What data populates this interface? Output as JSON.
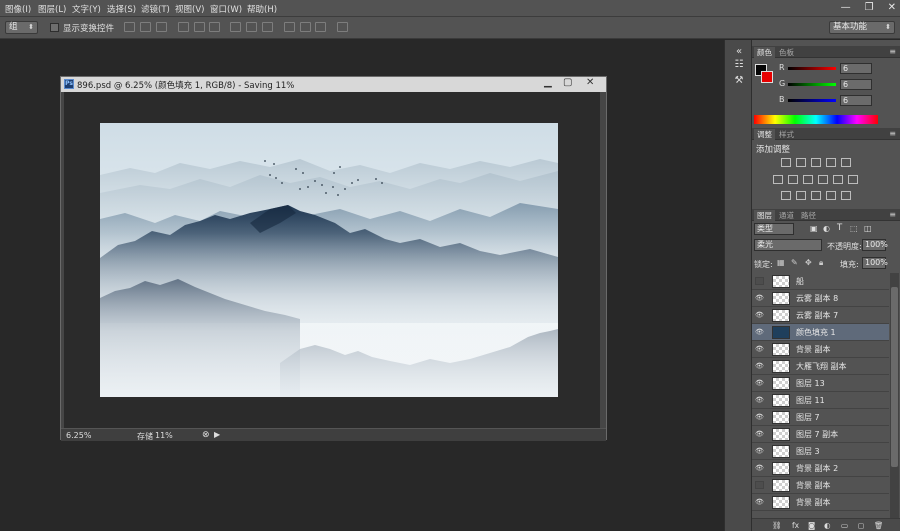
{
  "menu": [
    {
      "label": "图像(I)"
    },
    {
      "label": "图层(L)"
    },
    {
      "label": "文字(Y)"
    },
    {
      "label": "选择(S)"
    },
    {
      "label": "滤镜(T)"
    },
    {
      "label": "视图(V)"
    },
    {
      "label": "窗口(W)"
    },
    {
      "label": "帮助(H)"
    }
  ],
  "options": {
    "select_value": "组",
    "show_transform": "显示变换控件",
    "workspace": "基本功能"
  },
  "document": {
    "title": "896.psd @ 6.25% (颜色填充 1, RGB/8) - Saving 11%",
    "zoom": "6.25%",
    "status_label": "存储",
    "status_progress": "11%"
  },
  "color_panel": {
    "tabs": [
      "颜色",
      "色板"
    ],
    "r_label": "R",
    "g_label": "G",
    "b_label": "B",
    "r_value": "6",
    "g_value": "6",
    "b_value": "6",
    "fg_color": "#060606",
    "bg_color": "#e60000"
  },
  "adjust_panel": {
    "tabs": [
      "调整",
      "样式"
    ],
    "title": "添加调整"
  },
  "layers_panel": {
    "tabs": [
      "图层",
      "通道",
      "路径"
    ],
    "kind": "类型",
    "blend_mode": "柔光",
    "opacity_label": "不透明度:",
    "opacity_value": "100%",
    "lock_label": "锁定:",
    "fill_label": "填充:",
    "fill_value": "100%",
    "layers": [
      {
        "name": "船",
        "visible": false,
        "type": "transparent",
        "selected": false
      },
      {
        "name": "云雾 副本 8",
        "visible": true,
        "type": "transparent",
        "selected": false
      },
      {
        "name": "云雾 副本 7",
        "visible": true,
        "type": "transparent",
        "selected": false
      },
      {
        "name": "颜色填充 1",
        "visible": true,
        "type": "fill",
        "selected": true
      },
      {
        "name": "背景 副本",
        "visible": true,
        "type": "transparent",
        "selected": false
      },
      {
        "name": "大雁飞翔 副本",
        "visible": true,
        "type": "transparent",
        "selected": false
      },
      {
        "name": "图层 13",
        "visible": true,
        "type": "transparent",
        "selected": false
      },
      {
        "name": "图层 11",
        "visible": true,
        "type": "transparent",
        "selected": false
      },
      {
        "name": "图层 7",
        "visible": true,
        "type": "transparent",
        "selected": false
      },
      {
        "name": "图层 7 副本",
        "visible": true,
        "type": "transparent",
        "selected": false
      },
      {
        "name": "图层 3",
        "visible": true,
        "type": "transparent",
        "selected": false
      },
      {
        "name": "背景 副本 2",
        "visible": true,
        "type": "transparent",
        "selected": false
      },
      {
        "name": "背景 副本",
        "visible": false,
        "type": "transparent",
        "selected": false
      },
      {
        "name": "背景 副本",
        "visible": true,
        "type": "transparent",
        "selected": false
      }
    ]
  }
}
